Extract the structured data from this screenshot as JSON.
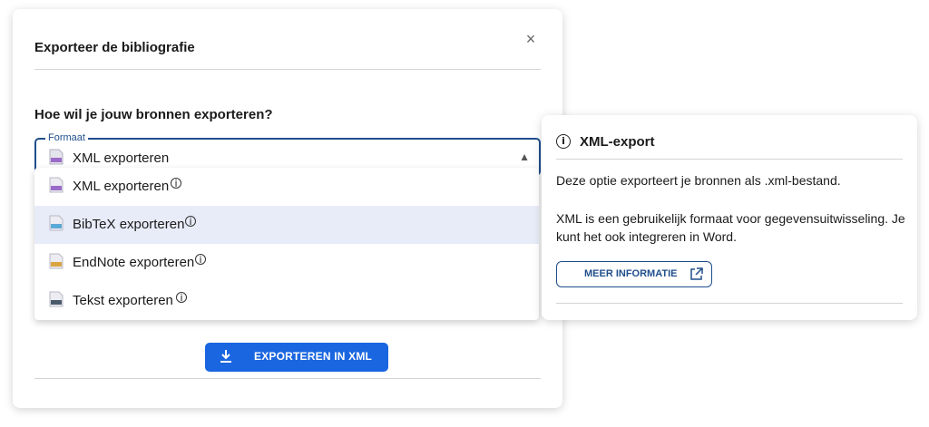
{
  "dialog": {
    "title": "Exporteer de bibliografie",
    "close_symbol": "×",
    "question": "Hoe wil je jouw bronnen exporteren?",
    "select": {
      "legend": "Formaat",
      "value": "XML exporteren",
      "icon": "xml-file-icon",
      "chevron": "chevron-up-icon"
    },
    "options": [
      {
        "label": "XML exporteren",
        "icon": "xml-file-icon",
        "color": "#9b6bc9",
        "selected": false
      },
      {
        "label": "BibTeX exporteren",
        "icon": "bibtex-file-icon",
        "color": "#5aa9d6",
        "selected": true
      },
      {
        "label": "EndNote exporteren",
        "icon": "endnote-file-icon",
        "color": "#d9a441",
        "selected": false
      },
      {
        "label": "Tekst exporteren",
        "icon": "text-file-icon",
        "color": "#4a5a6a",
        "selected": false
      }
    ],
    "info_symbol": "i",
    "export_button": "EXPORTEREN IN XML"
  },
  "info_panel": {
    "title": "XML-export",
    "icon_symbol": "i",
    "text1": "Deze optie exporteert je bronnen als .xml-bestand.",
    "text2": "XML is een gebruikelijk formaat voor gegevensuitwisseling. Je kunt het ook integreren in Word.",
    "more_button": "MEER INFORMATIE"
  },
  "colors": {
    "accent": "#1a66e0",
    "border_blue": "#1f4e8c",
    "selected_row": "#e8ecf8"
  }
}
